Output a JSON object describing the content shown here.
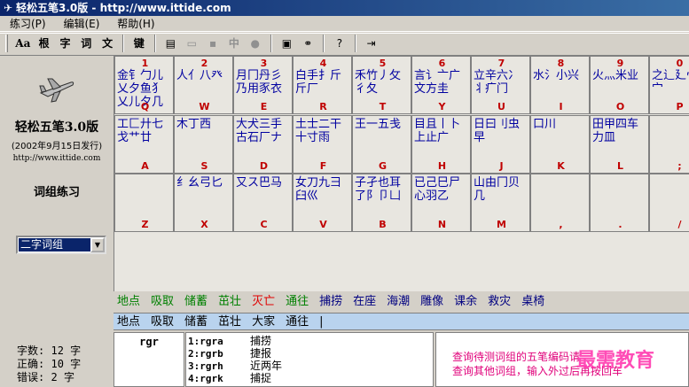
{
  "window": {
    "title": "轻松五笔3.0版 - http://www.ittide.com",
    "icon": "plane-icon"
  },
  "menu": [
    "练习(P)",
    "编辑(E)",
    "帮助(H)"
  ],
  "toolbar": {
    "text_buttons": [
      "Aa",
      "根",
      "字",
      "词",
      "文"
    ],
    "key_button": "键",
    "zhong_button": "中"
  },
  "left": {
    "app_name": "轻松五笔3.0版",
    "date": "(2002年9月15日发行)",
    "url": "http://www.ittide.com",
    "mode_label": "词组练习",
    "mode_select": "二字词组"
  },
  "keyboard": {
    "row1": [
      {
        "num": "1",
        "comp": "金钅勹儿乂夕鱼犭乂儿夕几",
        "key": "Q"
      },
      {
        "num": "2",
        "comp": "人亻八癶",
        "key": "W"
      },
      {
        "num": "3",
        "comp": "月冂丹彡乃用豕衣",
        "key": "E"
      },
      {
        "num": "4",
        "comp": "白手扌斤斤厂",
        "key": "R"
      },
      {
        "num": "5",
        "comp": "禾竹丿攵彳夂",
        "key": "T"
      },
      {
        "num": "6",
        "comp": "言讠亠广文方圭",
        "key": "Y"
      },
      {
        "num": "7",
        "comp": "立辛六冫丬疒门",
        "key": "U"
      },
      {
        "num": "8",
        "comp": "水氵小兴",
        "key": "I"
      },
      {
        "num": "9",
        "comp": "火灬米业",
        "key": "O"
      },
      {
        "num": "0",
        "comp": "之辶廴冖宀",
        "key": "P"
      }
    ],
    "row2": [
      {
        "comp": "工匚廾七戈艹廿",
        "key": "A"
      },
      {
        "comp": "木丁西",
        "key": "S"
      },
      {
        "comp": "大犬三手古石厂ナ",
        "key": "D"
      },
      {
        "comp": "土士二干十寸雨",
        "key": "F"
      },
      {
        "comp": "王一五戋",
        "key": "G"
      },
      {
        "comp": "目且丨卜上止广",
        "key": "H"
      },
      {
        "comp": "日曰刂虫早",
        "key": "J"
      },
      {
        "comp": "口川",
        "key": "K"
      },
      {
        "comp": "田甲四车力皿",
        "key": "L"
      },
      {
        "comp": "",
        "key": ";"
      }
    ],
    "row3": [
      {
        "comp": "",
        "key": "Z"
      },
      {
        "comp": "纟幺弓匕",
        "key": "X"
      },
      {
        "comp": "又ス巴马",
        "key": "C"
      },
      {
        "comp": "女刀九彐臼巛",
        "key": "V"
      },
      {
        "comp": "子孑也耳了阝卩凵",
        "key": "B"
      },
      {
        "comp": "已己巳尸心羽乙",
        "key": "N"
      },
      {
        "comp": "山由冂贝几",
        "key": "M"
      },
      {
        "comp": "",
        "key": ","
      },
      {
        "comp": "",
        "key": "."
      },
      {
        "comp": "",
        "key": "/"
      }
    ]
  },
  "phrases": [
    {
      "text": "地点",
      "color": "#008000"
    },
    {
      "text": "吸取",
      "color": "#008000"
    },
    {
      "text": "储蓄",
      "color": "#008000"
    },
    {
      "text": "茁壮",
      "color": "#008000"
    },
    {
      "text": "灭亡",
      "color": "#e00000"
    },
    {
      "text": "通往",
      "color": "#008000"
    },
    {
      "text": "捕捞",
      "color": "#000080"
    },
    {
      "text": "在座",
      "color": "#000080"
    },
    {
      "text": "海潮",
      "color": "#000080"
    },
    {
      "text": "雕像",
      "color": "#000080"
    },
    {
      "text": "课余",
      "color": "#000080"
    },
    {
      "text": "救灾",
      "color": "#000080"
    },
    {
      "text": "桌椅",
      "color": "#000080"
    }
  ],
  "typed": [
    "地点",
    "吸取",
    "储蓄",
    "茁壮",
    "大家",
    "通往",
    "|"
  ],
  "stats": [
    {
      "label": "字数:",
      "value": "12",
      "unit": "字"
    },
    {
      "label": "正确:",
      "value": "10",
      "unit": "字"
    },
    {
      "label": "错误:",
      "value": "2",
      "unit": "字"
    }
  ],
  "code": "rgr",
  "candidates": [
    {
      "code": "1:rgra",
      "word": "捕捞"
    },
    {
      "code": "2:rgrb",
      "word": "捷报"
    },
    {
      "code": "3:rgrh",
      "word": "近两年"
    },
    {
      "code": "4:rgrk",
      "word": "捕捉"
    }
  ],
  "hint": {
    "line1": "查询待测词组的五笔编码请",
    "line2": "查询其他词组，输入外过后再按回车"
  },
  "watermark": "最需教育"
}
